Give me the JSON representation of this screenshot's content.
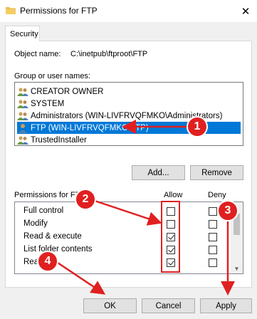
{
  "window": {
    "title": "Permissions for FTP",
    "close_glyph": "✕"
  },
  "tab": {
    "label": "Security"
  },
  "object": {
    "label": "Object name:",
    "value": "C:\\inetpub\\ftproot\\FTP"
  },
  "group_users": {
    "label": "Group or user names:",
    "items": [
      {
        "label": "CREATOR OWNER",
        "icon": "users-group-icon",
        "selected": false
      },
      {
        "label": "SYSTEM",
        "icon": "users-group-icon",
        "selected": false
      },
      {
        "label": "Administrators (WIN-LIVFRVQFMKO\\Administrators)",
        "icon": "users-group-icon",
        "selected": false
      },
      {
        "label": "FTP (WIN-LIVFRVQFMKO\\FTP)",
        "icon": "user-icon",
        "selected": true
      },
      {
        "label": "TrustedInstaller",
        "icon": "users-group-icon",
        "selected": false
      }
    ]
  },
  "buttons": {
    "add": "Add...",
    "remove": "Remove",
    "ok": "OK",
    "cancel": "Cancel",
    "apply": "Apply"
  },
  "permissions": {
    "label": "Permissions for FTP",
    "allow_header": "Allow",
    "deny_header": "Deny",
    "rows": [
      {
        "name": "Full control",
        "allow": false,
        "deny": false
      },
      {
        "name": "Modify",
        "allow": false,
        "deny": false
      },
      {
        "name": "Read & execute",
        "allow": true,
        "deny": false
      },
      {
        "name": "List folder contents",
        "allow": true,
        "deny": false
      },
      {
        "name": "Read",
        "allow": true,
        "deny": false
      }
    ]
  },
  "annotations": {
    "badges": [
      "1",
      "2",
      "3",
      "4"
    ],
    "color": "#e02020"
  },
  "colors": {
    "selection": "#0078d7",
    "annotation": "#e02020"
  }
}
